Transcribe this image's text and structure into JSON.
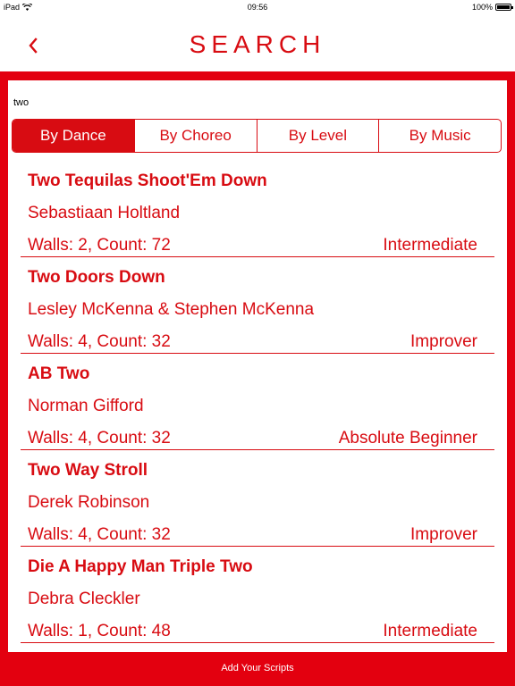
{
  "status_bar": {
    "device": "iPad",
    "time": "09:56",
    "battery": "100%"
  },
  "header": {
    "title": "SEARCH",
    "back_icon": "chevron-left-icon"
  },
  "search": {
    "value": "two"
  },
  "tabs": [
    {
      "label": "By Dance",
      "active": true
    },
    {
      "label": "By Choreo",
      "active": false
    },
    {
      "label": "By Level",
      "active": false
    },
    {
      "label": "By Music",
      "active": false
    }
  ],
  "results": [
    {
      "name": "Two Tequilas Shoot'Em Down",
      "choreographer": "Sebastiaan Holtland",
      "stats": "Walls: 2, Count: 72",
      "level": "Intermediate"
    },
    {
      "name": "Two Doors Down",
      "choreographer": "Lesley McKenna & Stephen McKenna",
      "stats": "Walls: 4, Count: 32",
      "level": "Improver"
    },
    {
      "name": "AB Two",
      "choreographer": "Norman Gifford",
      "stats": "Walls: 4, Count: 32",
      "level": "Absolute Beginner"
    },
    {
      "name": "Two Way Stroll",
      "choreographer": "Derek Robinson",
      "stats": "Walls: 4, Count: 32",
      "level": "Improver"
    },
    {
      "name": "Die A Happy Man Triple Two",
      "choreographer": "Debra Cleckler",
      "stats": "Walls: 1, Count: 48",
      "level": "Intermediate"
    }
  ],
  "footer": {
    "link": "Add Your Scripts"
  },
  "colors": {
    "accent": "#d80c12",
    "frame": "#e3000f"
  }
}
